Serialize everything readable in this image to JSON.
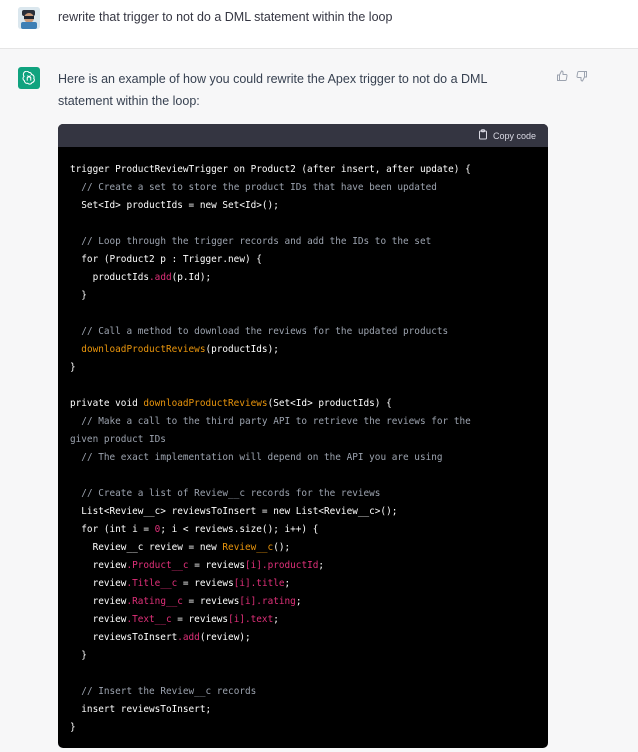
{
  "user_message": {
    "text": "rewrite that trigger to not do a DML statement within the loop"
  },
  "assistant_message": {
    "intro": "Here is an example of how you could rewrite the Apex trigger to not do a DML statement within the loop:",
    "copy_label": "Copy code",
    "code_lines": [
      [
        {
          "t": "trigger ProductReviewTrigger on Product2 (after insert, after update) {"
        }
      ],
      [
        {
          "t": "  "
        },
        {
          "t": "// Create a set to store the product IDs that have been updated",
          "k": "c"
        }
      ],
      [
        {
          "t": "  Set<Id> productIds = new Set<Id>();"
        }
      ],
      [
        {
          "t": ""
        }
      ],
      [
        {
          "t": "  "
        },
        {
          "t": "// Loop through the trigger records and add the IDs to the set",
          "k": "c"
        }
      ],
      [
        {
          "t": "  for (Product2 p : Trigger.new) {"
        }
      ],
      [
        {
          "t": "    productIds"
        },
        {
          "t": ".add",
          "k": "p"
        },
        {
          "t": "(p.Id);"
        }
      ],
      [
        {
          "t": "  }"
        }
      ],
      [
        {
          "t": ""
        }
      ],
      [
        {
          "t": "  "
        },
        {
          "t": "// Call a method to download the reviews for the updated products",
          "k": "c"
        }
      ],
      [
        {
          "t": "  "
        },
        {
          "t": "downloadProductReviews",
          "k": "m"
        },
        {
          "t": "(productIds);"
        }
      ],
      [
        {
          "t": "}"
        }
      ],
      [
        {
          "t": ""
        }
      ],
      [
        {
          "t": "private void "
        },
        {
          "t": "downloadProductReviews",
          "k": "m"
        },
        {
          "t": "(Set<Id> productIds) {"
        }
      ],
      [
        {
          "t": "  "
        },
        {
          "t": "// Make a call to the third party API to retrieve the reviews for the",
          "k": "c"
        }
      ],
      [
        {
          "t": "given product IDs",
          "k": "c"
        }
      ],
      [
        {
          "t": "  "
        },
        {
          "t": "// The exact implementation will depend on the API you are using",
          "k": "c"
        }
      ],
      [
        {
          "t": ""
        }
      ],
      [
        {
          "t": "  "
        },
        {
          "t": "// Create a list of Review__c records for the reviews",
          "k": "c"
        }
      ],
      [
        {
          "t": "  List<Review__c> reviewsToInsert = new List<Review__c>();"
        }
      ],
      [
        {
          "t": "  for (int i = "
        },
        {
          "t": "0",
          "k": "n"
        },
        {
          "t": "; i < reviews.size(); i++) {"
        }
      ],
      [
        {
          "t": "    Review__c review = new "
        },
        {
          "t": "Review__c",
          "k": "m"
        },
        {
          "t": "();"
        }
      ],
      [
        {
          "t": "    review"
        },
        {
          "t": ".Product__c",
          "k": "p"
        },
        {
          "t": " = reviews"
        },
        {
          "t": "[i].productId",
          "k": "p"
        },
        {
          "t": ";"
        }
      ],
      [
        {
          "t": "    review"
        },
        {
          "t": ".Title__c",
          "k": "p"
        },
        {
          "t": " = reviews"
        },
        {
          "t": "[i].title",
          "k": "p"
        },
        {
          "t": ";"
        }
      ],
      [
        {
          "t": "    review"
        },
        {
          "t": ".Rating__c",
          "k": "p"
        },
        {
          "t": " = reviews"
        },
        {
          "t": "[i].rating",
          "k": "p"
        },
        {
          "t": ";"
        }
      ],
      [
        {
          "t": "    review"
        },
        {
          "t": ".Text__c",
          "k": "p"
        },
        {
          "t": " = reviews"
        },
        {
          "t": "[i].text",
          "k": "p"
        },
        {
          "t": ";"
        }
      ],
      [
        {
          "t": "    reviewsToInsert"
        },
        {
          "t": ".add",
          "k": "p"
        },
        {
          "t": "(review);"
        }
      ],
      [
        {
          "t": "  }"
        }
      ],
      [
        {
          "t": ""
        }
      ],
      [
        {
          "t": "  "
        },
        {
          "t": "// Insert the Review__c records",
          "k": "c"
        }
      ],
      [
        {
          "t": "  insert reviewsToInsert;"
        }
      ],
      [
        {
          "t": "}"
        }
      ]
    ]
  },
  "colors": {
    "assistant_avatar": "#10a37f",
    "code_background": "#000000",
    "code_header": "#343541",
    "comment": "#9ca3af",
    "method": "#e9950c",
    "property": "#df3079"
  },
  "icons": {
    "user_avatar": "user-avatar-icon",
    "assistant_avatar": "openai-logo-icon",
    "copy": "clipboard-icon",
    "thumbs_up": "thumbs-up-icon",
    "thumbs_down": "thumbs-down-icon"
  }
}
